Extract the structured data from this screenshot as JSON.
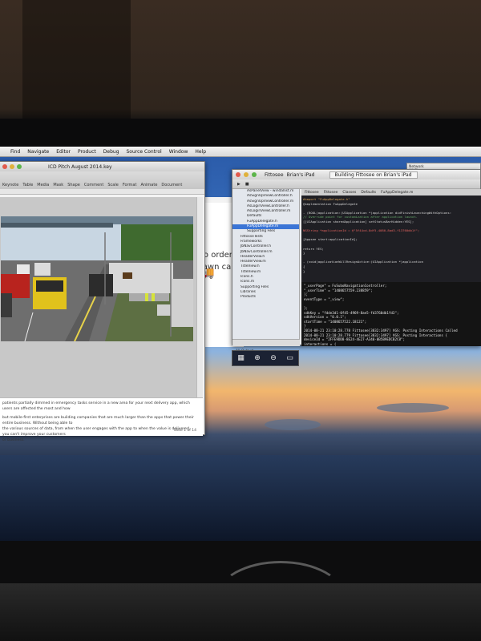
{
  "menubar": {
    "items": [
      "Find",
      "Navigate",
      "Editor",
      "Product",
      "Debug",
      "Source Control",
      "Window",
      "Help"
    ]
  },
  "keynote": {
    "title": "ICD Pitch August 2014.key",
    "toolbar": [
      "Keynote",
      "Table",
      "Media",
      "Mask",
      "Shape",
      "Comment",
      "Scale",
      "Format",
      "Animate",
      "Document"
    ],
    "notes_line1": "patients partially dimmed in emergency tasks service in a new area for your next delivery app, which users are affected the most and how",
    "notes_line2": "but mobile-first enterprises are building companies that are much larger than the apps that power their entire business. Without being able to",
    "notes_line3": "the various sources of data, from when the user engages with the app to when the value is delivered, you can't improve your customers",
    "notes_line4": "or business.",
    "slide_indicator": "Slide 1 of 14"
  },
  "browser": {
    "line1": "to order s",
    "line2": "lawn care"
  },
  "xcode": {
    "window_title": "Building Fittosee on Brian's iPad",
    "toolbar": [
      "Fittosee",
      "Brian's iPad"
    ],
    "editor_tabs": [
      "Fittosee",
      "Fittosee",
      "Classes",
      "Defaults",
      "FuAppDelegate.m"
    ],
    "navigator": [
      "AsPanelView - windallist.m",
      "AsSignUpViewController.h",
      "AsSignUpViewController.m",
      "AsLoginViewController.h",
      "AsLoginViewController.m",
      "Defaults",
      "FuAppDelegate.h",
      "FuAppDelegate.m",
      "Supporting Files",
      "FittosseTests",
      "Frameworks",
      "JbNavController.h",
      "JbNavController.m",
      "HeaderView.h",
      "HeaderView.m",
      "TitleView.h",
      "TitleView.m",
      "Icons.h",
      "Icons.m",
      "Supporting Files",
      "Libraries",
      "Products"
    ],
    "code": [
      "#import \"FuAppDelegate.h\"",
      "@implementation FuAppDelegate",
      "",
      "- (BOOL)application:(UIApplication *)application didFinishLaunchingWithOptions:",
      "    // Override point for customization after application launch.",
      "    [[UIApplication sharedApplication] setStatusBarHidden:YES];",
      "",
      "    NSString *applicationId = @\"5f44cd-8df5-4080-8ad3-f13760db1f\";",
      "",
      "    [Appsee start:applicationId];",
      "",
      "    return YES;",
      "}",
      "",
      "- (void)applicationWillResignActive:(UIApplication *)application",
      "{",
      "}"
    ],
    "console": [
      "\"_userPage\" = FuSuboNavigationController;",
      "    \"_userTime\" = \"1408657559.238859\";",
      "};",
      "eventType = \"_view\";",
      "",
      "};",
      "sdkKey = \"fdde3d1-0f45-4969-8ae5-fd3760db1fd3\";",
      "sdkVersion = \"0.0.1\";",
      "startTime = \"1408657522.18121\";",
      "}",
      "2014-08-21 23:10:28.778 Fittosee[3832:3497] VGS: Posting Interactions Called",
      "2014-08-21 23:10:28.779 Fittosee[3832:3497] VGS: Posting Interactions {",
      "    deviceId = \"2FFE9DD8-8E24-4E27-A340-0B5B9EDCB2C8\";",
      "    interactions = ("
    ],
    "console_footer": "All Output"
  },
  "network_window": {
    "line1": "Network",
    "line2": "Wi-Fi"
  },
  "colors": {
    "desktop_sky": "#3f78c6",
    "sunset": "#f2b66d",
    "console_bg": "#141414",
    "editor_bg": "#1f1f24",
    "selection": "#3b75d6"
  }
}
